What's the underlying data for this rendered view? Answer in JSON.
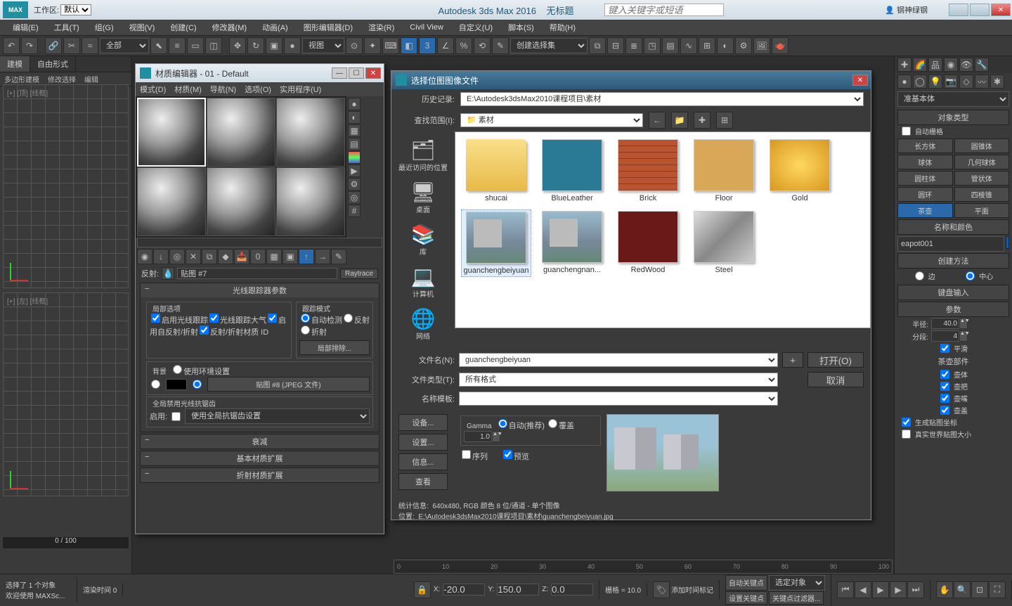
{
  "titlebar": {
    "workspace_label": "工作区: ",
    "workspace_value": "默认",
    "app_title": "Autodesk 3ds Max 2016",
    "doc_title": "无标题",
    "search_placeholder": "键入关键字或短语",
    "username": "钢神绿钢"
  },
  "menubar": [
    "编辑(E)",
    "工具(T)",
    "组(G)",
    "视图(V)",
    "创建(C)",
    "修改器(M)",
    "动画(A)",
    "图形编辑器(D)",
    "渲染(R)",
    "Civil View",
    "自定义(U)",
    "脚本(S)",
    "帮助(H)"
  ],
  "toolbar": {
    "selector": "全部",
    "view": "视图",
    "create_set": "创建选择集"
  },
  "leftpanel": {
    "tabs": [
      "建模",
      "自由形式"
    ],
    "subtabs": [
      "多边形建模",
      "修改选择",
      "编辑"
    ],
    "vp_top": "[+] [顶] [线框]",
    "vp_left": "[+] [左] [线框]",
    "frames": "0 / 100"
  },
  "rightpanel": {
    "dropdown": "准基本体",
    "obj_type_hdr": "对象类型",
    "autogrid": "自动栅格",
    "prims": [
      [
        "长方体",
        "圆锥体"
      ],
      [
        "球体",
        "几何球体"
      ],
      [
        "圆柱体",
        "管状体"
      ],
      [
        "圆环",
        "四棱锥"
      ],
      [
        "茶壶",
        "平面"
      ]
    ],
    "name_color": "名称和颜色",
    "obj_name": "eapot001",
    "create_method": "创建方法",
    "edge": "边",
    "center": "中心",
    "kbd_input": "键盘输入",
    "params": "参数",
    "radius_lbl": "半径:",
    "radius": "40.0",
    "segs_lbl": "分段:",
    "segs": "4",
    "smooth": "平滑",
    "teapot_parts": "茶壶部件",
    "parts": [
      "壶体",
      "壶把",
      "壶嘴",
      "壶盖"
    ],
    "gen_map": "生成贴图坐标",
    "real_world": "真实世界贴图大小"
  },
  "mateditor": {
    "title": "材质编辑器 - 01 - Default",
    "menu": [
      "模式(D)",
      "材质(M)",
      "导航(N)",
      "选项(O)",
      "实用程序(U)"
    ],
    "reflect": "反射:",
    "map_name": "贴图 #7",
    "raytrace": "Raytrace",
    "rollout1": "光线跟踪器参数",
    "local_opts": "局部选项",
    "trace_mode": "跟踪模式",
    "opts": [
      "启用光线跟踪",
      "光线跟踪大气",
      "启用自反射/折射",
      "反射/折射材质 ID"
    ],
    "modes": [
      "自动检测",
      "反射",
      "折射"
    ],
    "local_exclude": "局部排除...",
    "background": "背景",
    "use_env": "使用环境设置",
    "bgmap": "贴图 #8 (JPEG 文件)",
    "antialias_hdr": "全局禁用光线抗锯齿",
    "enable": "启用:",
    "antialias_opt": "使用全局抗锯齿设置",
    "roll_atten": "衰减",
    "roll_basic": "基本材质扩展",
    "roll_refr": "折射材质扩展"
  },
  "filedlg": {
    "title": "选择位图图像文件",
    "history_lbl": "历史记录:",
    "history": "E:\\Autodesk3dsMax2010课程项目\\素材",
    "lookin_lbl": "查找范围(I):",
    "lookin": "素材",
    "places": [
      "最近访问的位置",
      "桌面",
      "库",
      "计算机",
      "网络"
    ],
    "files": [
      {
        "name": "shucai",
        "type": "folder"
      },
      {
        "name": "BlueLeather",
        "bg": "#2a7a95"
      },
      {
        "name": "Brick",
        "bg": "repeating-linear-gradient(#b85530 0 8px,#8a3a20 8px 9px),repeating-linear-gradient(90deg,#b85530 0 18px,#8a3a20 18px 19px)"
      },
      {
        "name": "Floor",
        "bg": "#d8a858"
      },
      {
        "name": "Gold",
        "bg": "radial-gradient(#ffd860,#d89820)"
      },
      {
        "name": "guanchengbeiyuan",
        "type": "photo",
        "sel": true
      },
      {
        "name": "guanchengnan...",
        "type": "photo"
      },
      {
        "name": "RedWood",
        "bg": "#6a1818"
      },
      {
        "name": "Steel",
        "bg": "linear-gradient(135deg,#ddd,#888,#ccc)"
      }
    ],
    "filename_lbl": "文件名(N):",
    "filename": "guanchengbeiyuan",
    "filetype_lbl": "文件类型(T):",
    "filetype": "所有格式",
    "nametpl_lbl": "名称模板:",
    "open": "打开(O)",
    "cancel": "取消",
    "device": "设备...",
    "setup": "设置...",
    "info": "信息...",
    "view": "查看",
    "gamma": "Gamma",
    "gamma_auto": "自动(推荐)",
    "gamma_override": "覆盖",
    "gamma_val": "1.0",
    "sequence": "序列",
    "preview": "预览",
    "stats_lbl": "统计信息:",
    "stats": "640x480, RGB 颜色 8 位/通道 - 单个图像",
    "loc_lbl": "位置:",
    "loc": "E:\\Autodesk3dsMax2010课程项目\\素材\\guanchengbeiyuan.jpg"
  },
  "statusbar": {
    "sel": "选择了 1 个对象",
    "welcome": "欢迎使用",
    "maxscript": "MAXSc...",
    "render_time": "渲染时间 0",
    "x": "-20.0",
    "y": "150.0",
    "z": "0.0",
    "grid": "栅格 = 10.0",
    "autokey_lbl": "自动关键点",
    "autokey_sel": "选定对象",
    "setkey": "设置关键点",
    "keyfilter": "关键点过滤器...",
    "add_time": "添加时间标记"
  }
}
